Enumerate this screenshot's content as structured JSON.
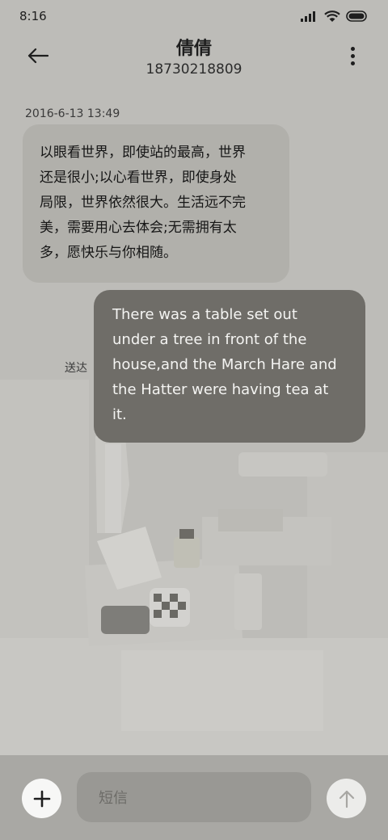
{
  "status_bar": {
    "time": "8:16",
    "icons": [
      "signal-icon",
      "wifi-icon",
      "battery-icon"
    ]
  },
  "header": {
    "contact_name": "倩倩",
    "contact_number": "18730218809",
    "back_icon": "arrow-left-icon",
    "more_icon": "more-vertical-icon"
  },
  "conversation": {
    "timestamp": "2016-6-13 13:49",
    "incoming": {
      "lines": [
        "以眼看世界，即使站的最高，世界",
        "还是很小;以心看世界，即使身处",
        "局限，世界依然很大。生活远不完",
        "美，需要用心去体会;无需拥有太",
        "多，愿快乐与你相随。"
      ]
    },
    "outgoing": {
      "lines": [
        "There was a table set out",
        "under a tree in front of the",
        "house,and the March Hare and",
        "the Hatter were having tea at",
        "it."
      ],
      "status": "送达"
    }
  },
  "composer": {
    "add_icon": "plus-icon",
    "placeholder": "短信",
    "send_icon": "arrow-up-icon"
  },
  "colors": {
    "background": "#bdbcb8",
    "incoming_bubble": "#b1b0ab",
    "outgoing_bubble": "#6f6d68",
    "bottom_bar": "#a9a8a4"
  }
}
